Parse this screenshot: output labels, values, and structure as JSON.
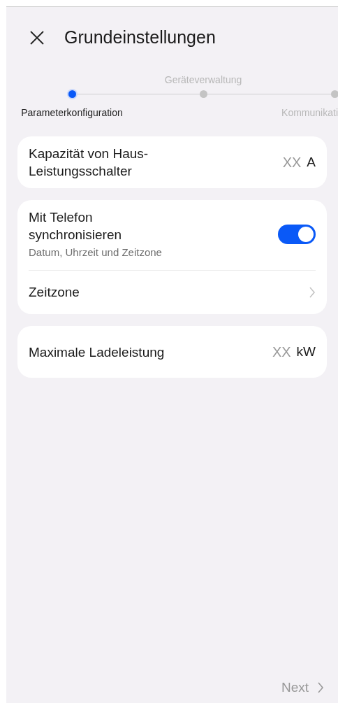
{
  "header": {
    "title": "Grundeinstellungen"
  },
  "steps": [
    {
      "label": "Parameterkonfiguration",
      "selected": true
    },
    {
      "label": "Geräteverwaltung",
      "selected": false
    },
    {
      "label": "Kommunikati",
      "selected": false
    }
  ],
  "cards": [
    {
      "rows": [
        {
          "kind": "input",
          "label": "Kapazität von Haus-Leistungsschalter",
          "placeholder": "XX",
          "unit": "A"
        }
      ]
    },
    {
      "rows": [
        {
          "kind": "toggle",
          "label": "Mit Telefon synchronisieren",
          "description": "Datum, Uhrzeit und Zeitzone",
          "on": true
        },
        {
          "kind": "link",
          "label": "Zeitzone"
        }
      ]
    },
    {
      "rows": [
        {
          "kind": "input",
          "label": "Maximale Ladeleistung",
          "placeholder": "XX",
          "unit": "kW"
        }
      ]
    }
  ],
  "footer": {
    "next": "Next"
  }
}
